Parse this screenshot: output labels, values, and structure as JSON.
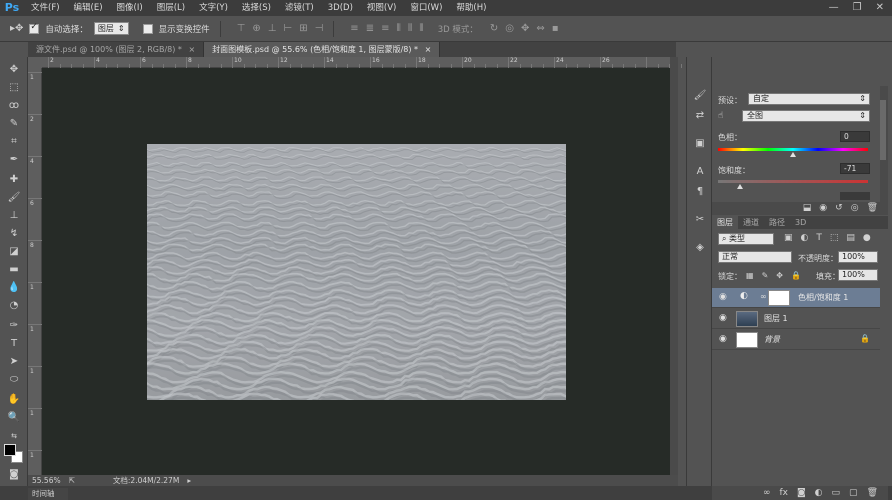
{
  "app": {
    "logo": "Ps",
    "menu": [
      "文件(F)",
      "编辑(E)",
      "图像(I)",
      "图层(L)",
      "文字(Y)",
      "选择(S)",
      "滤镜(T)",
      "3D(D)",
      "视图(V)",
      "窗口(W)",
      "帮助(H)"
    ],
    "window_controls": [
      "—",
      "❐",
      "✕"
    ]
  },
  "options": {
    "auto_select_label": "自动选择：",
    "auto_select_value": "图层",
    "show_transform_label": "显示变换控件",
    "mode_3d_label": "3D 模式："
  },
  "tabs": [
    {
      "label": "源文件.psd @ 100% (图层 2, RGB/8) *",
      "close": "×"
    },
    {
      "label": "封面图模板.psd @ 55.6% (色相/饱和度 1, 图层蒙版/8) *",
      "close": "×"
    }
  ],
  "ruler": {
    "h_labels": [
      "2",
      "4",
      "6",
      "8",
      "10",
      "12",
      "14",
      "16",
      "18",
      "20",
      "22",
      "24",
      "26"
    ],
    "v_labels": [
      "1",
      "2",
      "4",
      "6",
      "8",
      "1",
      "1",
      "1",
      "1",
      "1"
    ]
  },
  "status": {
    "zoom": "55.56%",
    "doc": "文档:2.04M/2.27M",
    "arrow": "▸",
    "timeline": "时间轴"
  },
  "properties": {
    "preset_label": "预设：",
    "preset_value": "自定",
    "channel_value": "全图",
    "hue_label": "色相：",
    "hue_value": "0",
    "saturation_label": "饱和度：",
    "saturation_value": "-71",
    "hue_level": 0.5,
    "saturation_level": 0.145
  },
  "layers": {
    "tabs": [
      "图层",
      "通道",
      "路径",
      "3D"
    ],
    "filter_value": "类型",
    "blend_mode": "正常",
    "opacity_label": "不透明度：",
    "opacity_value": "100%",
    "lock_label": "锁定：",
    "fill_label": "填充：",
    "fill_value": "100%",
    "items": [
      {
        "name": "色相/饱和度 1",
        "selected": true
      },
      {
        "name": "图层 1",
        "selected": false
      },
      {
        "name": "背景",
        "selected": false
      }
    ]
  },
  "colors": {
    "canvas_bg": "#262b27",
    "panel_bg": "#535353",
    "selection": "#6c7d94",
    "accent": "#3fa9f5"
  }
}
